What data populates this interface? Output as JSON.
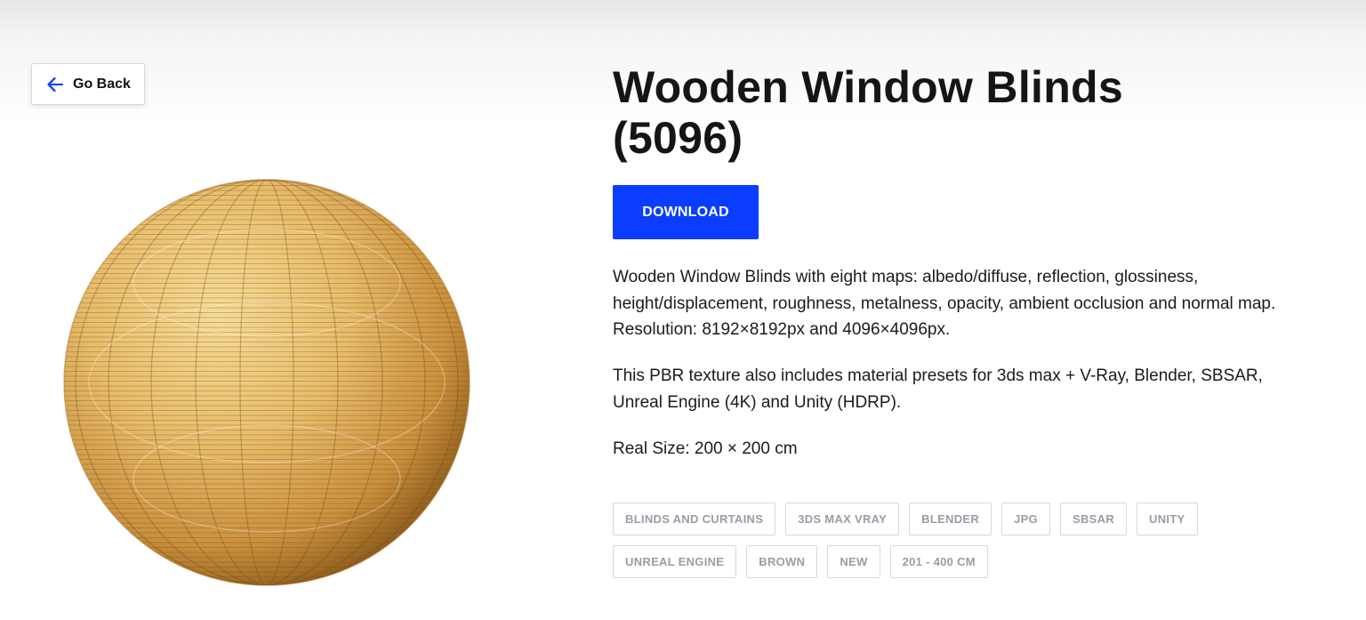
{
  "nav": {
    "back_label": "Go Back",
    "back_icon": "arrow-left-icon",
    "accent": "#1747f5"
  },
  "product": {
    "title_line1": "Wooden Window Blinds",
    "title_line2": "(5096)",
    "download_label": "DOWNLOAD",
    "download_color": "#0a3dff",
    "description": [
      "Wooden Window Blinds with eight maps: albedo/diffuse, reflection, glossiness, height/displacement, roughness, metalness, opacity, ambient occlusion and normal map. Resolution: 8192×8192px and 4096×4096px.",
      "This PBR texture also includes material presets for 3ds max + V-Ray, Blender, SBSAR, Unreal Engine (4K) and Unity (HDRP).",
      "Real Size: 200 × 200 cm"
    ]
  },
  "tags": {
    "row1": [
      "BLINDS AND CURTAINS",
      "3DS MAX VRAY",
      "BLENDER",
      "JPG",
      "SBSAR",
      "UNITY"
    ],
    "row2": [
      "UNREAL ENGINE",
      "BROWN",
      "NEW",
      "201 - 400 CM"
    ]
  },
  "preview": {
    "image": "wooden-blinds-sphere",
    "colors": [
      "#f3d48a",
      "#d9a64e",
      "#8a5a1c"
    ]
  }
}
